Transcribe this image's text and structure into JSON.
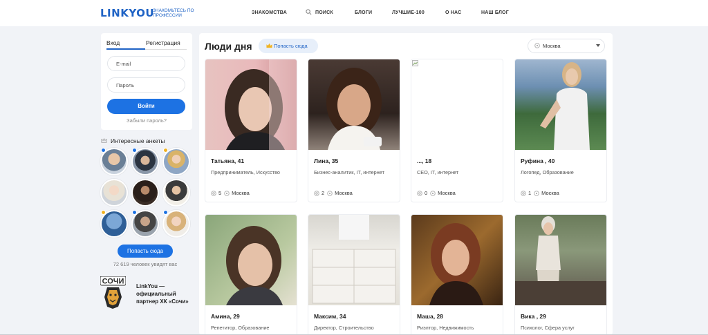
{
  "header": {
    "logo": "LINKYOU",
    "logo_subtitle": "ЗНАКОМЬТЕСЬ ПО ПРОФЕССИИ",
    "nav": [
      "ЗНАКОМСТВА",
      "ПОИСК",
      "БЛОГИ",
      "ЛУЧШИЕ-100",
      "О НАС",
      "НАШ БЛОГ"
    ]
  },
  "login": {
    "tab_login": "Вход",
    "tab_register": "Регистрация",
    "email_placeholder": "E-mail",
    "password_placeholder": "Пароль",
    "submit": "Войти",
    "forgot": "Забыли пароль?"
  },
  "sidebar": {
    "interesting_title": "Интересные анкеты",
    "get_here_button": "Попасть сюда",
    "viewers": "72 619 человек увидят вас",
    "partner_text": "LinkYou — официальный партнер ХК «Сочи»",
    "partner_logo_text": "СОЧИ"
  },
  "main": {
    "title": "Люди дня",
    "promo_button": "Попасть сюда",
    "city": "Москва"
  },
  "profiles": [
    {
      "name": "Татьяна, 41",
      "job": "Предприниматель, Искусство",
      "photos": "5",
      "city": "Москва"
    },
    {
      "name": "Лина, 35",
      "job": "Бизнес-аналитик, IT, интернет",
      "photos": "2",
      "city": "Москва"
    },
    {
      "name": "..., 18",
      "job": "CEO, IT, интернет",
      "photos": "0",
      "city": "Москва"
    },
    {
      "name": "Руфина , 40",
      "job": "Логопед, Образование",
      "photos": "1",
      "city": "Москва"
    },
    {
      "name": "Амина, 29",
      "job": "Репетитор, Образование"
    },
    {
      "name": "Максим, 34",
      "job": "Директор, Строительство"
    },
    {
      "name": "Маша, 28",
      "job": "Риэлтор, Недвижимость"
    },
    {
      "name": "Вика , 29",
      "job": "Психолог, Сфера услуг"
    }
  ],
  "colors": {
    "brand": "#1f63c5",
    "button": "#1d72e3",
    "background": "#f1f3f7"
  }
}
